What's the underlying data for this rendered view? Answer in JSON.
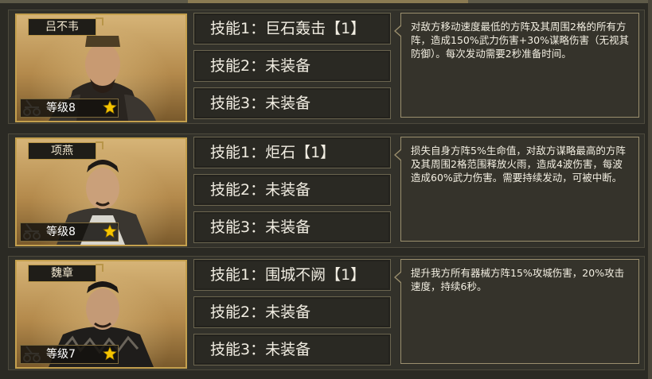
{
  "generals": [
    {
      "name": "吕不韦",
      "level_label": "等级8",
      "skills": [
        "技能1：巨石轰击【1】",
        "技能2：未装备",
        "技能3：未装备"
      ],
      "description": "对敌方移动速度最低的方阵及其周围2格的所有方阵，造成150%武力伤害+30%谋略伤害（无视其防御）。每次发动需要2秒准备时间。"
    },
    {
      "name": "项燕",
      "level_label": "等级8",
      "skills": [
        "技能1：炬石【1】",
        "技能2：未装备",
        "技能3：未装备"
      ],
      "description": "损失自身方阵5%生命值，对敌方谋略最高的方阵及其周围2格范围释放火雨，造成4波伤害，每波造成60%武力伤害。需要持续发动，可被中断。"
    },
    {
      "name": "魏章",
      "level_label": "等级7",
      "skills": [
        "技能1：围城不阙【1】",
        "技能2：未装备",
        "技能3：未装备"
      ],
      "description": "提升我方所有器械方阵15%攻城伤害，20%攻击速度，持续6秒。"
    }
  ],
  "icons": {
    "catapult": "catapult-icon",
    "star": "star-icon"
  },
  "colors": {
    "gold_border": "#c4a04e",
    "panel_bg": "#32312a",
    "star": "#f5c400"
  }
}
